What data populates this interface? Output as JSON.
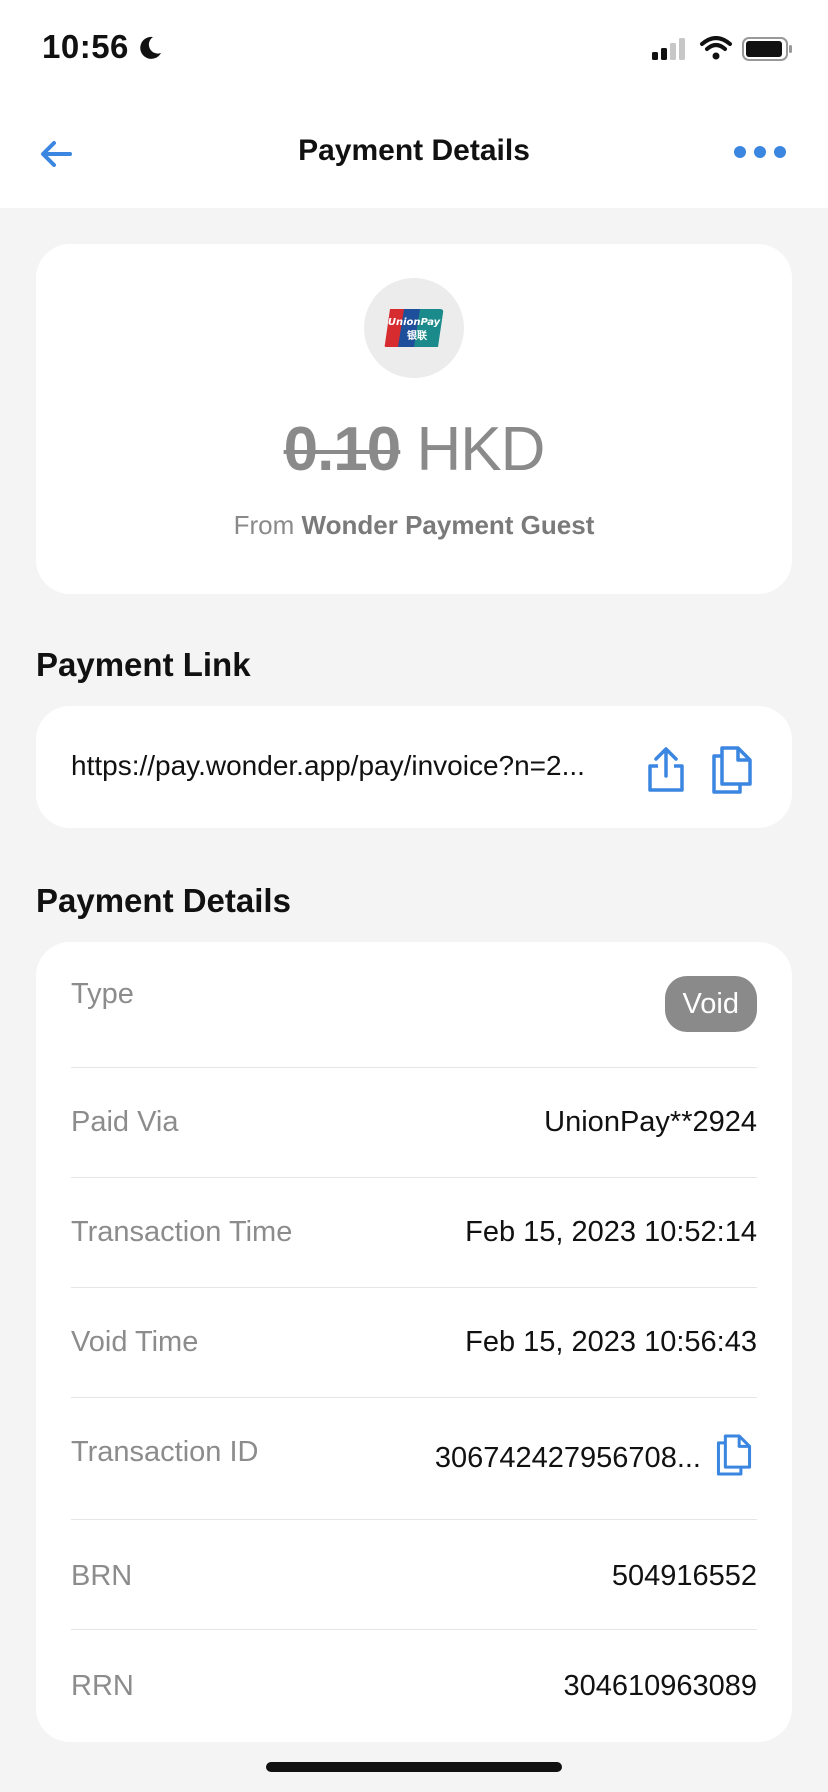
{
  "status_bar": {
    "time": "10:56",
    "icons": [
      "moon-icon",
      "signal-icon",
      "wifi-icon",
      "battery-icon"
    ]
  },
  "nav": {
    "title": "Payment Details",
    "back_icon": "arrow-left-icon",
    "more_icon": "more-horizontal-icon",
    "accent_color": "#3a86e0"
  },
  "amount_card": {
    "payment_method_logo": "unionpay-logo",
    "amount": "0.10",
    "currency": "HKD",
    "from_prefix": "From",
    "from_name": "Wonder Payment Guest"
  },
  "payment_link": {
    "heading": "Payment Link",
    "url": "https://pay.wonder.app/pay/invoice?n=2..."
  },
  "details": {
    "heading": "Payment Details",
    "type_label": "Type",
    "type_value": "Void",
    "rows": [
      {
        "label": "Paid Via",
        "value": "UnionPay**2924"
      },
      {
        "label": "Transaction Time",
        "value": "Feb 15, 2023 10:52:14"
      },
      {
        "label": "Void Time",
        "value": "Feb 15, 2023 10:56:43"
      },
      {
        "label": "Transaction ID",
        "value": "306742427956708..."
      },
      {
        "label": "BRN",
        "value": "504916552"
      },
      {
        "label": "RRN",
        "value": "304610963089"
      }
    ]
  }
}
